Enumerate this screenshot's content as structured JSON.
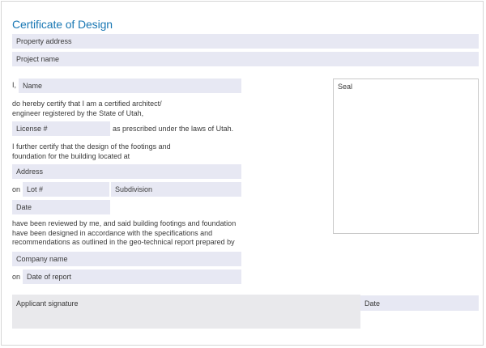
{
  "title": "Certificate of Design",
  "fields": {
    "property_address": "Property address",
    "project_name": "Project name",
    "name": "Name",
    "license": "License #",
    "address": "Address",
    "lot": "Lot #",
    "subdivision": "Subdivision",
    "date": "Date",
    "company_name": "Company name",
    "date_of_report": "Date of report",
    "applicant_signature": "Applicant signature",
    "signature_date": "Date"
  },
  "labels": {
    "i": "I,",
    "on_1": "on",
    "on_2": "on",
    "prescribed": "as prescribed under the laws of Utah."
  },
  "paragraphs": {
    "certify_1": "do hereby certify that I am a certified architect/",
    "certify_2": "engineer registered by the State of Utah,",
    "further_1": "I further certify that the design of the footings and",
    "further_2": "foundation for the building located at",
    "reviewed_1": "have been reviewed by me, and said building footings and foundation",
    "reviewed_2": "have been designed in accordance with the specifications and",
    "reviewed_3": "recommendations as outlined in the geo-technical report prepared by"
  },
  "seal": {
    "label": "Seal"
  }
}
